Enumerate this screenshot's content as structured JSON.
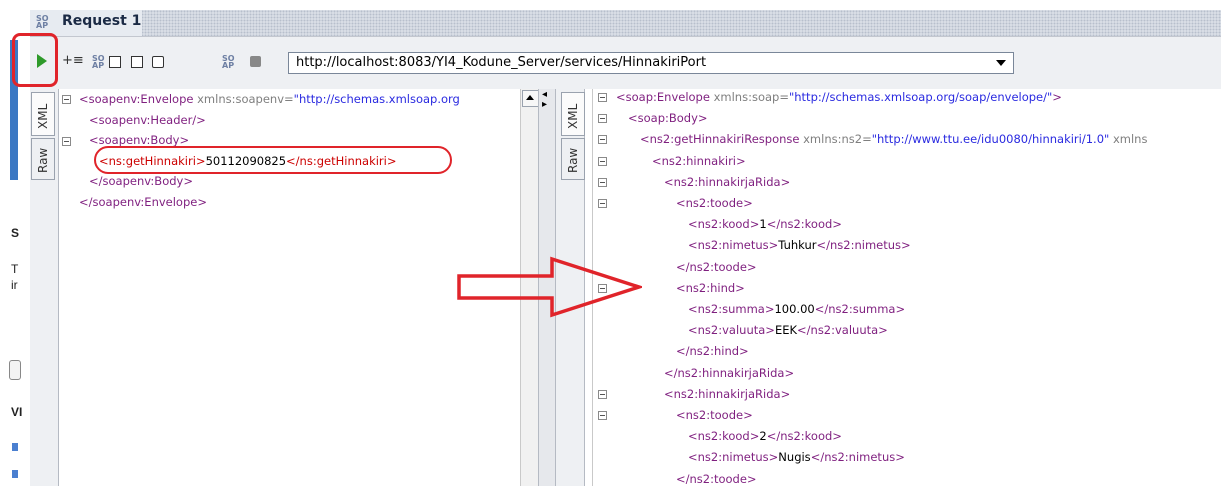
{
  "window": {
    "title": "Request 1",
    "title_icon": "soap-icon"
  },
  "toolbar": {
    "run": "run-request",
    "buttons": [
      "add-assertion-icon",
      "soap-icon",
      "layout-icon",
      "window-icon",
      "duplicate-icon",
      "soap-icon",
      "stop-icon"
    ],
    "endpoint": "http://localhost:8083/YI4_Kodune_Server/services/HinnakiriPort"
  },
  "left_panel": {
    "tabs": [
      "XML",
      "Raw"
    ],
    "lines": [
      {
        "indent": 0,
        "parts": [
          [
            "tag",
            "<soapenv:Envelope "
          ],
          [
            "attr",
            "xmlns:soapenv="
          ],
          [
            "aval",
            "\"http://schemas.xmlsoap.org"
          ]
        ]
      },
      {
        "indent": 1,
        "parts": [
          [
            "tag",
            "<soapenv:Header/>"
          ]
        ]
      },
      {
        "indent": 1,
        "parts": [
          [
            "tag",
            "<soapenv:Body>"
          ]
        ]
      },
      {
        "indent": 2,
        "parts": [
          [
            "tagv",
            "<ns:getHinnakiri>"
          ],
          [
            "txt",
            "50112090825"
          ],
          [
            "tagv",
            "</ns:getHinnakiri>"
          ]
        ]
      },
      {
        "indent": 1,
        "parts": [
          [
            "tag",
            "</soapenv:Body>"
          ]
        ]
      },
      {
        "indent": 0,
        "parts": [
          [
            "tag",
            "</soapenv:Envelope>"
          ]
        ]
      }
    ]
  },
  "right_panel": {
    "tabs": [
      "XML",
      "Raw"
    ],
    "lines": [
      {
        "indent": 0,
        "parts": [
          [
            "tag",
            "<soap:Envelope "
          ],
          [
            "attr",
            "xmlns:soap="
          ],
          [
            "aval",
            "\"http://schemas.xmlsoap.org/soap/envelope/\""
          ],
          [
            "tag",
            ">"
          ]
        ]
      },
      {
        "indent": 1,
        "parts": [
          [
            "tag",
            "<soap:Body>"
          ]
        ]
      },
      {
        "indent": 2,
        "parts": [
          [
            "tag",
            "<ns2:getHinnakiriResponse "
          ],
          [
            "attr",
            "xmlns:ns2="
          ],
          [
            "aval",
            "\"http://www.ttu.ee/idu0080/hinnakiri/1.0\""
          ],
          [
            "attr",
            " xmlns"
          ]
        ]
      },
      {
        "indent": 3,
        "parts": [
          [
            "tag",
            "<ns2:hinnakiri>"
          ]
        ]
      },
      {
        "indent": 4,
        "parts": [
          [
            "tag",
            "<ns2:hinnakirjaRida>"
          ]
        ]
      },
      {
        "indent": 5,
        "parts": [
          [
            "tag",
            "<ns2:toode>"
          ]
        ]
      },
      {
        "indent": 6,
        "parts": [
          [
            "tag",
            "<ns2:kood>"
          ],
          [
            "txt",
            "1"
          ],
          [
            "tag",
            "</ns2:kood>"
          ]
        ]
      },
      {
        "indent": 6,
        "parts": [
          [
            "tag",
            "<ns2:nimetus>"
          ],
          [
            "txt",
            "Tuhkur"
          ],
          [
            "tag",
            "</ns2:nimetus>"
          ]
        ]
      },
      {
        "indent": 5,
        "parts": [
          [
            "tag",
            "</ns2:toode>"
          ]
        ]
      },
      {
        "indent": 5,
        "parts": [
          [
            "tag",
            "<ns2:hind>"
          ]
        ]
      },
      {
        "indent": 6,
        "parts": [
          [
            "tag",
            "<ns2:summa>"
          ],
          [
            "txt",
            "100.00"
          ],
          [
            "tag",
            "</ns2:summa>"
          ]
        ]
      },
      {
        "indent": 6,
        "parts": [
          [
            "tag",
            "<ns2:valuuta>"
          ],
          [
            "txt",
            "EEK"
          ],
          [
            "tag",
            "</ns2:valuuta>"
          ]
        ]
      },
      {
        "indent": 5,
        "parts": [
          [
            "tag",
            "</ns2:hind>"
          ]
        ]
      },
      {
        "indent": 4,
        "parts": [
          [
            "tag",
            "</ns2:hinnakirjaRida>"
          ]
        ]
      },
      {
        "indent": 4,
        "parts": [
          [
            "tag",
            "<ns2:hinnakirjaRida>"
          ]
        ]
      },
      {
        "indent": 5,
        "parts": [
          [
            "tag",
            "<ns2:toode>"
          ]
        ]
      },
      {
        "indent": 6,
        "parts": [
          [
            "tag",
            "<ns2:kood>"
          ],
          [
            "txt",
            "2"
          ],
          [
            "tag",
            "</ns2:kood>"
          ]
        ]
      },
      {
        "indent": 6,
        "parts": [
          [
            "tag",
            "<ns2:nimetus>"
          ],
          [
            "txt",
            "Nugis"
          ],
          [
            "tag",
            "</ns2:nimetus>"
          ]
        ]
      },
      {
        "indent": 5,
        "parts": [
          [
            "tag",
            "</ns2:toode>"
          ]
        ]
      }
    ]
  },
  "background_window": {
    "letters": [
      "S",
      "T",
      "ir",
      "VI"
    ]
  },
  "annotation_colors": {
    "highlight": "#e0242a",
    "selected_line": "#ffffc8"
  }
}
